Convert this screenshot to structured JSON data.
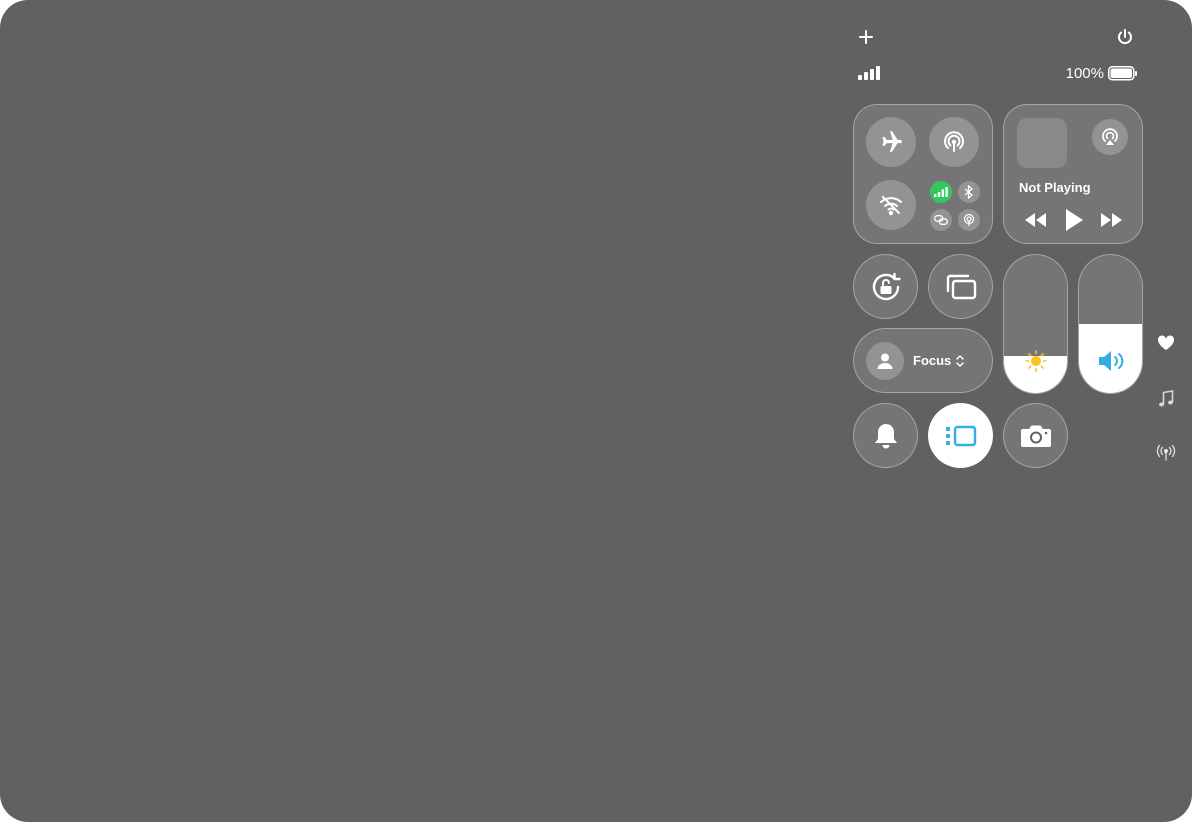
{
  "status": {
    "battery_text": "100%",
    "battery_level": 1.0
  },
  "icons": {
    "add": "plus-icon",
    "power": "power-icon",
    "signal": "cellular-signal-icon",
    "battery": "battery-icon",
    "airplane": "airplane-icon",
    "airdrop": "airdrop-icon",
    "wifi": "wifi-off-icon",
    "cellular": "cellular-data-icon",
    "bluetooth": "bluetooth-icon",
    "vpn": "link-icon",
    "hotspot": "hotspot-icon",
    "airplay": "airplay-icon",
    "rewind": "rewind-icon",
    "play": "play-icon",
    "forward": "fast-forward-icon",
    "rotation": "orientation-lock-icon",
    "mirroring": "screen-mirroring-icon",
    "focus": "person-icon",
    "focus_chevron": "chevron-updown-icon",
    "brightness": "sun-icon",
    "volume": "speaker-icon",
    "silent": "bell-icon",
    "stage_manager": "stage-manager-icon",
    "camera": "camera-icon",
    "favorites": "heart-icon",
    "music": "music-note-icon",
    "connectivity": "antenna-icon"
  },
  "media": {
    "status": "Not Playing"
  },
  "focus": {
    "label": "Focus"
  },
  "sliders": {
    "brightness_level": 0.27,
    "volume_level": 0.5
  },
  "colors": {
    "background": "#616163",
    "cellular_active": "#34c759",
    "accent_blue": "#32ade6",
    "brightness_yellow": "#f7c325"
  }
}
